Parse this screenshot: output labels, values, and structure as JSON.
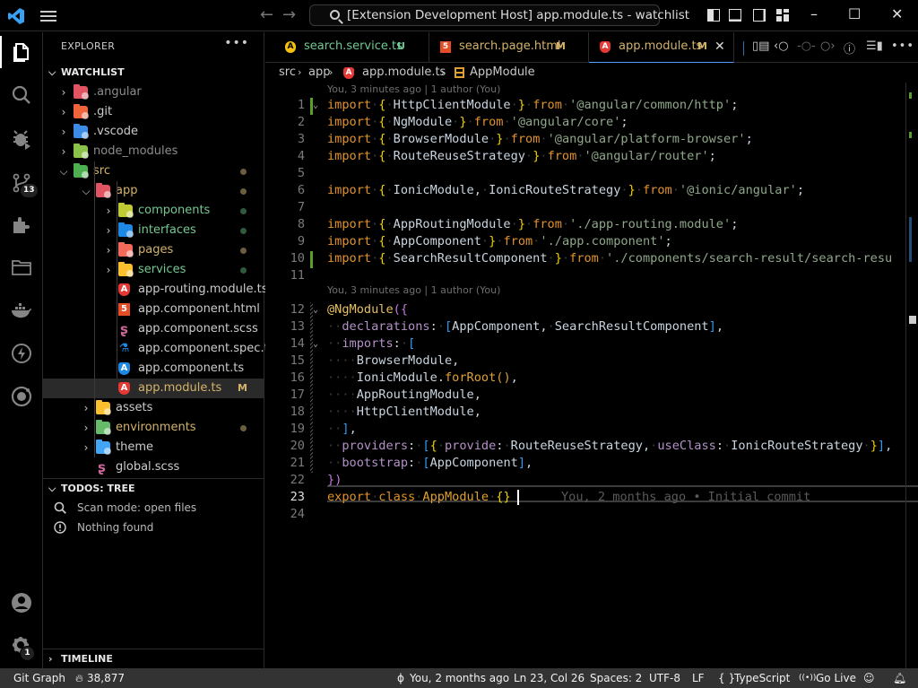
{
  "titlebar": {
    "search_text": "[Extension Development Host] app.module.ts - watchlist",
    "back_icon": "arrow-left-icon",
    "forward_icon": "arrow-right-icon",
    "minimize": "–",
    "maximize": "☐",
    "close": "✕",
    "back": "←",
    "forward": "→"
  },
  "activity_bar": {
    "items": [
      {
        "name": "explorer",
        "icon": "files-icon",
        "active": true
      },
      {
        "name": "search",
        "icon": "search-icon"
      },
      {
        "name": "run-debug",
        "icon": "debug-icon"
      },
      {
        "name": "source-control",
        "icon": "source-control-icon",
        "badge": "13"
      },
      {
        "name": "extensions",
        "icon": "extensions-icon"
      },
      {
        "name": "folders",
        "icon": "folder-icon"
      },
      {
        "name": "docker",
        "icon": "docker-icon"
      },
      {
        "name": "thunder",
        "icon": "lightning-icon"
      },
      {
        "name": "ionic",
        "icon": "ionic-icon"
      }
    ],
    "bottom": [
      {
        "name": "accounts",
        "icon": "account-icon"
      },
      {
        "name": "manage",
        "icon": "gear-icon",
        "badge": "1"
      }
    ]
  },
  "sidebar": {
    "title": "EXPLORER",
    "more": "•••",
    "workspace": "WATCHLIST",
    "tree": [
      {
        "name": ".angular",
        "depth": 0,
        "type": "folder",
        "open": false,
        "color": "#e05561",
        "text_color": "#8c8c8c"
      },
      {
        "name": ".git",
        "depth": 0,
        "type": "folder",
        "open": false,
        "color": "#f0643c",
        "text_color": "#cccccc"
      },
      {
        "name": ".vscode",
        "depth": 0,
        "type": "folder",
        "open": false,
        "color": "#3c8ce6",
        "text_color": "#cccccc"
      },
      {
        "name": "node_modules",
        "depth": 0,
        "type": "folder",
        "open": false,
        "color": "#8bc34a",
        "text_color": "#8c8c8c"
      },
      {
        "name": "src",
        "depth": 0,
        "type": "folder",
        "open": true,
        "color": "#4caf50",
        "text_color": "#d4b36a",
        "dot": "#6b5d40"
      },
      {
        "name": "app",
        "depth": 1,
        "type": "folder",
        "open": true,
        "color": "#e05561",
        "text_color": "#d4b36a",
        "dot": "#6b5d40"
      },
      {
        "name": "components",
        "depth": 2,
        "type": "folder",
        "open": false,
        "color": "#c0ca33",
        "text_color": "#73c991",
        "dot": "#2f5a3c"
      },
      {
        "name": "interfaces",
        "depth": 2,
        "type": "folder",
        "open": false,
        "color": "#1e88e5",
        "text_color": "#73c991",
        "dot": "#2f5a3c"
      },
      {
        "name": "pages",
        "depth": 2,
        "type": "folder",
        "open": false,
        "color": "#f46a5a",
        "text_color": "#d4b36a",
        "dot": "#6b5d40"
      },
      {
        "name": "services",
        "depth": 2,
        "type": "folder",
        "open": false,
        "color": "#fbc02d",
        "text_color": "#73c991",
        "dot": "#2f5a3c"
      },
      {
        "name": "app-routing.module.ts",
        "depth": 2,
        "type": "file",
        "icon": "angular-icon",
        "icon_color": "#e53935",
        "text_color": "#cccccc"
      },
      {
        "name": "app.component.html",
        "depth": 2,
        "type": "file",
        "icon": "html5-icon",
        "icon_color": "#e44d26",
        "text_color": "#cccccc"
      },
      {
        "name": "app.component.scss",
        "depth": 2,
        "type": "file",
        "icon": "sass-icon",
        "icon_color": "#cd6799",
        "text_color": "#cccccc"
      },
      {
        "name": "app.component.spec.ts",
        "depth": 2,
        "type": "file",
        "icon": "flask-icon",
        "icon_color": "#1e88e5",
        "text_color": "#cccccc"
      },
      {
        "name": "app.component.ts",
        "depth": 2,
        "type": "file",
        "icon": "angular-icon",
        "icon_color": "#1e88e5",
        "text_color": "#cccccc"
      },
      {
        "name": "app.module.ts",
        "depth": 2,
        "type": "file",
        "icon": "angular-icon",
        "icon_color": "#e53935",
        "text_color": "#d4b36a",
        "decoration": "M",
        "selected": true
      },
      {
        "name": "assets",
        "depth": 1,
        "type": "folder",
        "open": false,
        "color": "#fbc02d",
        "text_color": "#cccccc"
      },
      {
        "name": "environments",
        "depth": 1,
        "type": "folder",
        "open": false,
        "color": "#66bb6a",
        "text_color": "#d4b36a",
        "dot": "#6b5d40"
      },
      {
        "name": "theme",
        "depth": 1,
        "type": "folder",
        "open": false,
        "color": "#42a5f5",
        "text_color": "#cccccc"
      },
      {
        "name": "global.scss",
        "depth": 1,
        "type": "file",
        "icon": "sass-icon",
        "icon_color": "#cd6799",
        "text_color": "#cccccc"
      }
    ],
    "todos": {
      "title": "TODOS: TREE",
      "items": [
        {
          "icon": "search-icon",
          "text": "Scan mode: open files"
        },
        {
          "icon": "info-icon",
          "text": "Nothing found"
        }
      ]
    },
    "timeline": "TIMELINE"
  },
  "tabs": [
    {
      "name": "search.service.ts",
      "icon": "angular-icon",
      "icon_color": "#f4c20d",
      "text_color": "#73c991",
      "decoration": "U",
      "deco_color": "#73c991"
    },
    {
      "name": "search.page.html",
      "icon": "html5-icon",
      "icon_color": "#e44d26",
      "text_color": "#d4b36a",
      "decoration": "M",
      "deco_color": "#d4b36a"
    },
    {
      "name": "app.module.ts",
      "icon": "angular-icon",
      "icon_color": "#e53935",
      "text_color": "#d4b36a",
      "decoration": "M",
      "deco_color": "#d4b36a",
      "active": true,
      "close": "✕"
    }
  ],
  "editor_actions": [
    "open-changes-icon",
    "git-previous-icon",
    "git-commit-icon",
    "git-next-icon",
    "git-graph-icon",
    "split-editor-icon",
    "more-actions-icon"
  ],
  "breadcrumb": {
    "parts": [
      "src",
      "app",
      "app.module.ts",
      "AppModule"
    ],
    "sep": "›"
  },
  "editor": {
    "codelens_1": "You, 3 minutes ago | 1 author (You)",
    "codelens_2": "You, 3 minutes ago | 1 author (You)",
    "blame_line_23": "You, 2 months ago • Initial commit",
    "current_line": 23,
    "lines": [
      {
        "n": "1",
        "code": "import { HttpClientModule } from '@angular/common/http';"
      },
      {
        "n": "2",
        "code": "import { NgModule } from '@angular/core';"
      },
      {
        "n": "3",
        "code": "import { BrowserModule } from '@angular/platform-browser';"
      },
      {
        "n": "4",
        "code": "import { RouteReuseStrategy } from '@angular/router';"
      },
      {
        "n": "5",
        "code": ""
      },
      {
        "n": "6",
        "code": "import { IonicModule, IonicRouteStrategy } from '@ionic/angular';"
      },
      {
        "n": "7",
        "code": ""
      },
      {
        "n": "8",
        "code": "import { AppRoutingModule } from './app-routing.module';"
      },
      {
        "n": "9",
        "code": "import { AppComponent } from './app.component';"
      },
      {
        "n": "10",
        "code": "import { SearchResultComponent } from './components/search-result/search-resu"
      },
      {
        "n": "11",
        "code": ""
      },
      {
        "n": "12",
        "code": "@NgModule({"
      },
      {
        "n": "13",
        "code": "  declarations: [AppComponent, SearchResultComponent],"
      },
      {
        "n": "14",
        "code": "  imports: ["
      },
      {
        "n": "15",
        "code": "    BrowserModule,"
      },
      {
        "n": "16",
        "code": "    IonicModule.forRoot(),"
      },
      {
        "n": "17",
        "code": "    AppRoutingModule,"
      },
      {
        "n": "18",
        "code": "    HttpClientModule,"
      },
      {
        "n": "19",
        "code": "  ],"
      },
      {
        "n": "20",
        "code": "  providers: [{ provide: RouteReuseStrategy, useClass: IonicRouteStrategy }],"
      },
      {
        "n": "21",
        "code": "  bootstrap: [AppComponent],"
      },
      {
        "n": "22",
        "code": "})"
      },
      {
        "n": "23",
        "code": "export class AppModule {}"
      },
      {
        "n": "24",
        "code": ""
      }
    ]
  },
  "statusbar": {
    "git_graph": "Git Graph",
    "flame_count": "38,877",
    "blame": "You, 2 months ago",
    "position": "Ln 23, Col 26",
    "spaces": "Spaces: 2",
    "encoding": "UTF-8",
    "eol": "LF",
    "language": "TypeScript",
    "language_icon": "{ }",
    "go_live": "Go Live",
    "go_live_icon": "broadcast-icon",
    "copilot_icon": "copilot-icon",
    "bell_icon": "bell-icon"
  }
}
